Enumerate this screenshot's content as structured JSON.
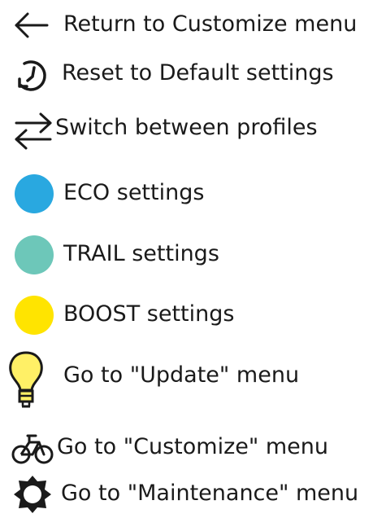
{
  "colors": {
    "text": "#1a1a1a",
    "eco": "#29a8e0",
    "trail": "#6dc7b9",
    "boost": "#ffe400",
    "bulb": "#fff066"
  },
  "items": [
    {
      "label": "Return to Customize menu",
      "icon": "arrow-left-icon"
    },
    {
      "label": "Reset to Default settings",
      "icon": "reset-icon"
    },
    {
      "label": "Switch between profiles",
      "icon": "swap-arrows-icon"
    },
    {
      "label": "ECO settings",
      "icon": "eco-dot-icon"
    },
    {
      "label": "TRAIL settings",
      "icon": "trail-dot-icon"
    },
    {
      "label": "BOOST settings",
      "icon": "boost-dot-icon"
    },
    {
      "label": "Go to \"Update\" menu",
      "icon": "lightbulb-icon"
    },
    {
      "label": "Go to \"Customize\" menu",
      "icon": "bicycle-icon"
    },
    {
      "label": "Go to \"Maintenance\" menu",
      "icon": "gear-icon"
    }
  ]
}
